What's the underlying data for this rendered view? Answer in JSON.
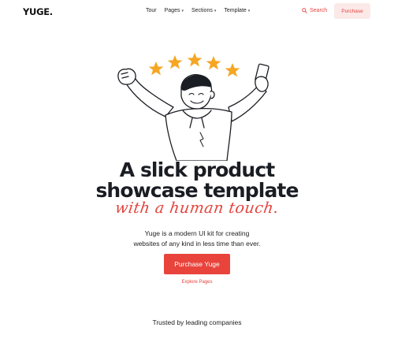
{
  "brand": {
    "logo": "YUGE."
  },
  "nav": {
    "items": [
      {
        "label": "Tour",
        "has_dropdown": false
      },
      {
        "label": "Pages",
        "has_dropdown": true
      },
      {
        "label": "Sections",
        "has_dropdown": true
      },
      {
        "label": "Template",
        "has_dropdown": true
      }
    ],
    "search_label": "Search",
    "purchase_label": "Purchase"
  },
  "hero": {
    "title_line1": "A slick product",
    "title_line2": "showcase template",
    "script_line": "with a human touch.",
    "description_line1": "Yuge is a modern UI kit for creating",
    "description_line2": "websites of any kind in less time than ever.",
    "cta_label": "Purchase Yuge",
    "secondary_link": "Explore Pages",
    "illustration_stars": 5
  },
  "trusted": {
    "text": "Trusted by leading companies"
  },
  "colors": {
    "accent": "#e8443c",
    "accent_soft": "#fbe9e8",
    "star": "#f5a623",
    "text": "#1b1d24"
  },
  "icons": {
    "search": "search-icon",
    "caret": "chevron-down-icon"
  }
}
